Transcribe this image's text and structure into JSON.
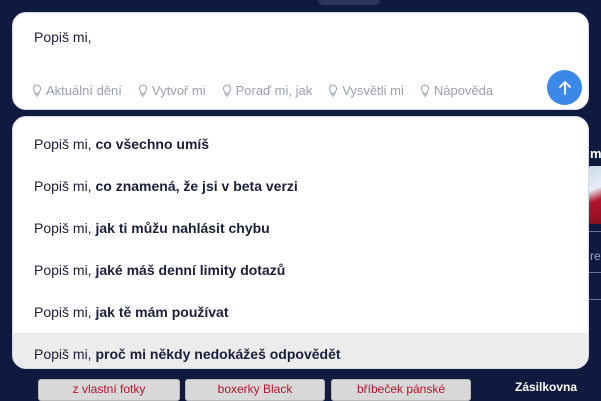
{
  "search": {
    "query": "Popiš mi,",
    "hints": [
      {
        "label": "Aktuální dění"
      },
      {
        "label": "Vytvoř mi"
      },
      {
        "label": "Poraď mi, jak"
      },
      {
        "label": "Vysvětli mi"
      },
      {
        "label": "Nápověda"
      }
    ],
    "submit_icon": "arrow-up-icon"
  },
  "suggestions": [
    {
      "prefix": "Popiš mi, ",
      "bold": "co všechno umíš",
      "active": false
    },
    {
      "prefix": "Popiš mi, ",
      "bold": "co znamená, že jsi v beta verzi",
      "active": false
    },
    {
      "prefix": "Popiš mi, ",
      "bold": "jak ti můžu nahlásit chybu",
      "active": false
    },
    {
      "prefix": "Popiš mi, ",
      "bold": "jaké máš denní limity dotazů",
      "active": false
    },
    {
      "prefix": "Popiš mi, ",
      "bold": "jak tě mám používat",
      "active": false
    },
    {
      "prefix": "Popiš mi, ",
      "bold": "proč mi někdy nedokážeš odpovědět",
      "active": true
    }
  ],
  "background": {
    "side_letter": "m",
    "side_text": "ren",
    "chips": [
      "z vlastní fotky",
      "boxerky Black",
      "bříbeček pánské"
    ],
    "zasilkovna": "Zásilkovna"
  },
  "colors": {
    "page_bg": "#0f1a3e",
    "accent": "#3b88e8",
    "hint_text": "#9aa0ad",
    "active_row": "#ececec"
  }
}
